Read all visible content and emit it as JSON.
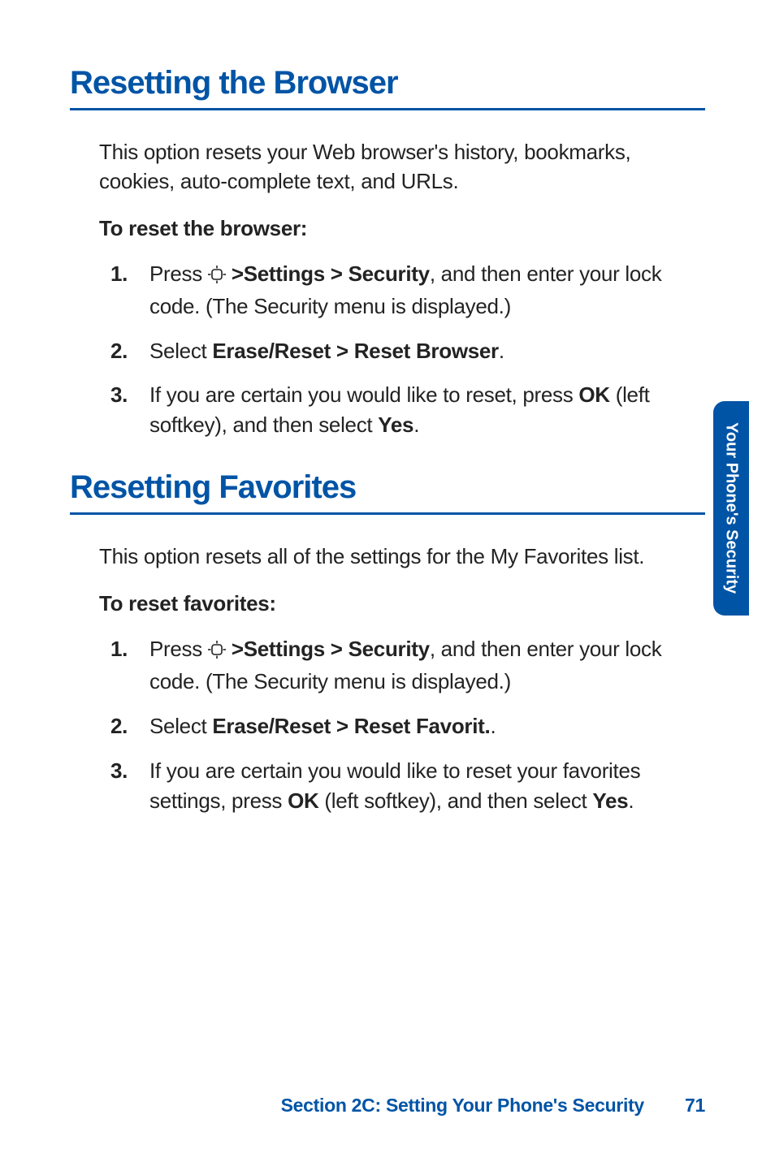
{
  "side_tab": "Your Phone's Security",
  "footer": {
    "section": "Section 2C: Setting Your Phone's Security",
    "page": "71"
  },
  "s1": {
    "title": "Resetting the Browser",
    "intro": "This option resets your Web browser's history, bookmarks, cookies, auto-complete text, and URLs.",
    "lead": "To reset the browser:",
    "step1_a": "Press ",
    "step1_b": " >Settings > Security",
    "step1_c": ", and then enter your lock code. (The Security menu is displayed.)",
    "step2_a": "Select ",
    "step2_b": "Erase/Reset > Reset Browser",
    "step2_c": ".",
    "step3_a": "If you are certain you would like to reset, press ",
    "step3_b": "OK",
    "step3_c": " (left softkey), and then select ",
    "step3_d": "Yes",
    "step3_e": "."
  },
  "s2": {
    "title": "Resetting Favorites",
    "intro": "This option resets all of the settings for the My Favorites list.",
    "lead": "To reset favorites:",
    "step1_a": "Press ",
    "step1_b": " >Settings > Security",
    "step1_c": ", and then enter your lock code. (The Security menu is displayed.)",
    "step2_a": "Select ",
    "step2_b": "Erase/Reset > Reset Favorit.",
    "step2_c": ".",
    "step3_a": " If you are certain you would like to reset your favorites settings, press ",
    "step3_b": "OK",
    "step3_c": " (left softkey), and then select ",
    "step3_d": "Yes",
    "step3_e": "."
  }
}
